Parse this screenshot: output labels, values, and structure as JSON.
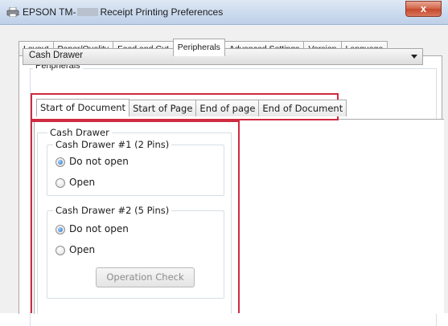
{
  "window": {
    "title_prefix": "EPSON TM-",
    "title_suffix": "Receipt Printing Preferences",
    "close_glyph": "x",
    "icons": {
      "app": "printer-icon",
      "close": "close-icon"
    }
  },
  "tabs": [
    {
      "label": "Layout",
      "active": false
    },
    {
      "label": "Paper/Quality",
      "active": false
    },
    {
      "label": "Feed and Cut",
      "active": false
    },
    {
      "label": "Peripherals",
      "active": true
    },
    {
      "label": "Advanced Settings",
      "active": false
    },
    {
      "label": "Version",
      "active": false
    },
    {
      "label": "Language",
      "active": false
    }
  ],
  "peripherals": {
    "legend": "Peripherals",
    "device_select": {
      "selected": "Cash Drawer"
    },
    "timing_tabs": [
      {
        "label": "Start of Document",
        "active": true
      },
      {
        "label": "Start of Page",
        "active": false
      },
      {
        "label": "End of page",
        "active": false
      },
      {
        "label": "End of Document",
        "active": false
      }
    ],
    "cash_drawer": {
      "legend": "Cash Drawer",
      "drawer1": {
        "legend": "Cash Drawer #1 (2 Pins)",
        "options": [
          {
            "label": "Do not open",
            "checked": true
          },
          {
            "label": "Open",
            "checked": false
          }
        ]
      },
      "drawer2": {
        "legend": "Cash Drawer #2 (5 Pins)",
        "options": [
          {
            "label": "Do not open",
            "checked": true
          },
          {
            "label": "Open",
            "checked": false
          }
        ]
      },
      "operation_check_label": "Operation Check"
    }
  },
  "colors": {
    "highlight": "#cf2a3f",
    "radio_dot": "#2d6fbd"
  }
}
